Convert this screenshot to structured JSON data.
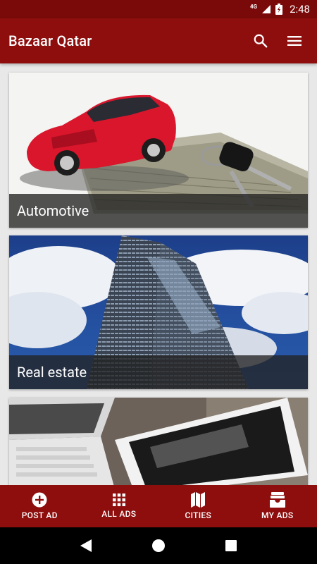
{
  "status_bar": {
    "network": "4G",
    "time": "2:48"
  },
  "app_bar": {
    "title": "Bazaar Qatar",
    "search_icon": "search-icon",
    "menu_icon": "menu-icon"
  },
  "categories": [
    {
      "label": "Automotive",
      "image": "red-car-keys-money"
    },
    {
      "label": "Real estate",
      "image": "skyscraper-sky"
    },
    {
      "label": "",
      "image": "laptop-tablet"
    }
  ],
  "bottom_nav": [
    {
      "label": "POST AD",
      "icon": "plus-circle-icon"
    },
    {
      "label": "ALL ADS",
      "icon": "grid-icon"
    },
    {
      "label": "CITIES",
      "icon": "map-icon"
    },
    {
      "label": "MY ADS",
      "icon": "inbox-icon"
    }
  ],
  "colors": {
    "primary": "#8e0e0e",
    "status_bar": "#7a0a0a",
    "background": "#e8e8e8"
  }
}
